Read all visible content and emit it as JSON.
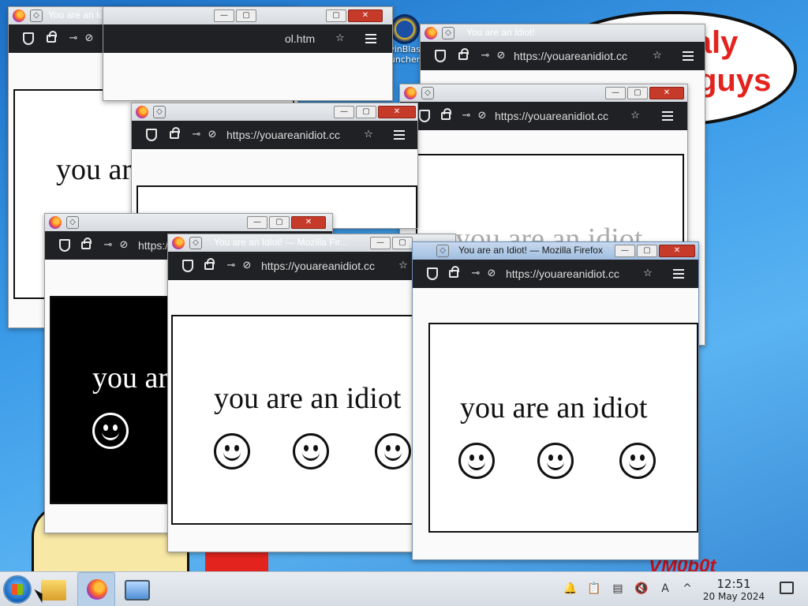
{
  "desktop": {
    "bubble_line1": "this is totaly",
    "bubble_line2": "guys",
    "corner_text": "VM0b0t",
    "icons": [
      {
        "label": "vinBlas",
        "label2": "uncher"
      }
    ]
  },
  "window_title": "You are an Idiot! — Mozilla Firefox",
  "window_title_short": "You are an Idiot! — Mozilla Fir...",
  "window_title_tab": "You are an Idiot!",
  "url": "https://youareanidiot.cc",
  "url_other": "ol.htm",
  "content_text": "you are an idiot",
  "content_text_partial": "you ar",
  "controls": {
    "minimize": "—",
    "maximize": "▢",
    "close": "✕"
  },
  "taskbar": {
    "time": "12:51",
    "date": "20 May 2024",
    "apps": [
      "start-menu",
      "file-manager",
      "firefox",
      "network-app"
    ]
  },
  "icons": [
    "shield-icon",
    "lock-icon",
    "permissions-icon",
    "tracking-icon",
    "star-icon",
    "menu-icon"
  ]
}
